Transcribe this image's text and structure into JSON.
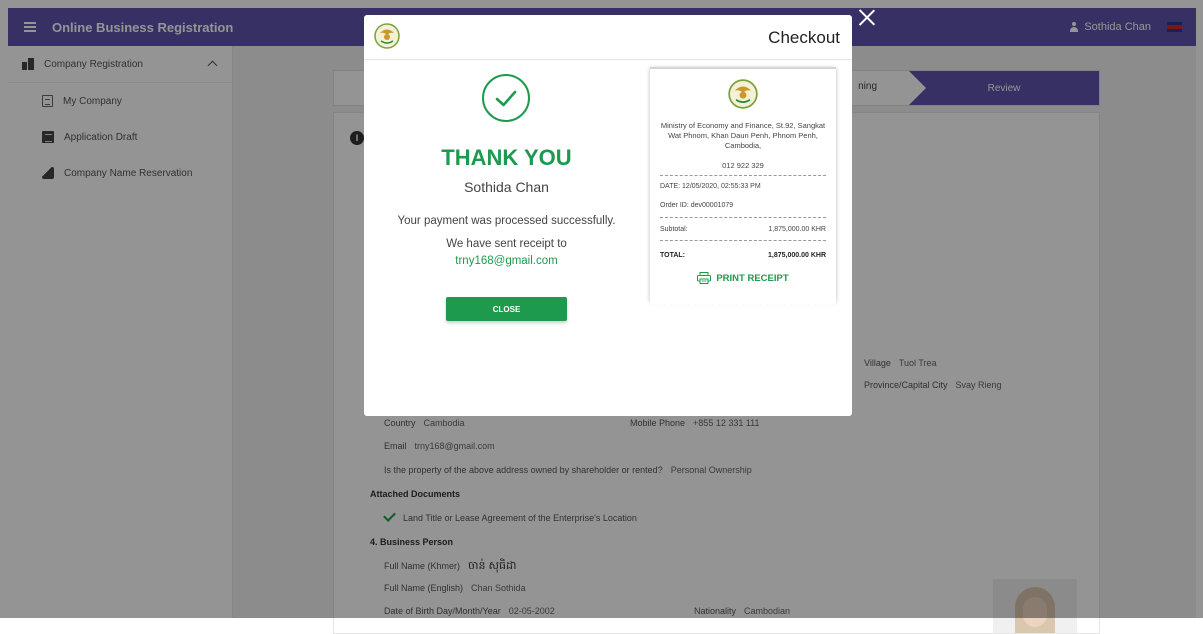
{
  "topbar": {
    "title": "Online Business Registration",
    "user_name": "Sothida Chan",
    "colors": {
      "bar": "#5e53ad"
    }
  },
  "sidebar": {
    "section_label": "Company Registration",
    "items": [
      {
        "label": "My Company",
        "icon": "document-icon"
      },
      {
        "label": "Application Draft",
        "icon": "draft-icon"
      },
      {
        "label": "Company Name Reservation",
        "icon": "stamp-icon"
      }
    ]
  },
  "stepper": {
    "partial_step_label": "ning",
    "active_step_label": "Review"
  },
  "details": {
    "info_badge": "I",
    "village_label": "Village",
    "village_value": "Tuol Trea",
    "province_label": "Province/Capital City",
    "province_value": "Svay Rieng",
    "country_label": "Country",
    "country_value": "Cambodia",
    "mobile_label": "Mobile Phone",
    "mobile_value": "+855 12 331 111",
    "email_label": "Email",
    "email_value": "trny168@gmail.com",
    "ownership_question": "Is the property of the above address owned by shareholder or rented?",
    "ownership_value": "Personal Ownership",
    "attached_heading": "Attached Documents",
    "attached_doc": "Land Title or Lease Agreement of the Enterprise's Location",
    "section4_heading": "4. Business Person",
    "khmer_label": "Full Name (Khmer)",
    "khmer_value": "ចាន់ សុធិដា",
    "english_label": "Full Name (English)",
    "english_value": "Chan Sothida",
    "dob_label": "Date of Birth Day/Month/Year",
    "dob_value": "02-05-2002",
    "nationality_label": "Nationality",
    "nationality_value": "Cambodian"
  },
  "modal": {
    "title": "Checkout",
    "thank_you": "THANK YOU",
    "user_name": "Sothida Chan",
    "message": "Your payment was processed successfully.",
    "receipt_sent": "We have sent receipt to",
    "email": "trny168@gmail.com",
    "close_label": "CLOSE",
    "colors": {
      "success": "#1e9a4e"
    }
  },
  "receipt": {
    "address": "Ministry of Economy and Finance, St.92, Sangkat Wat Phnom, Khan Daun Penh, Phnom Penh, Cambodia,",
    "phone": "012 922 329",
    "date": "DATE: 12/05/2020, 02:55:33 PM",
    "order_id": "Order ID: dev00001079",
    "subtotal_label": "Subtotal:",
    "subtotal_value": "1,875,000.00 KHR",
    "total_label": "TOTAL:",
    "total_value": "1,875,000.00 KHR",
    "print_label": "PRINT RECEIPT"
  }
}
